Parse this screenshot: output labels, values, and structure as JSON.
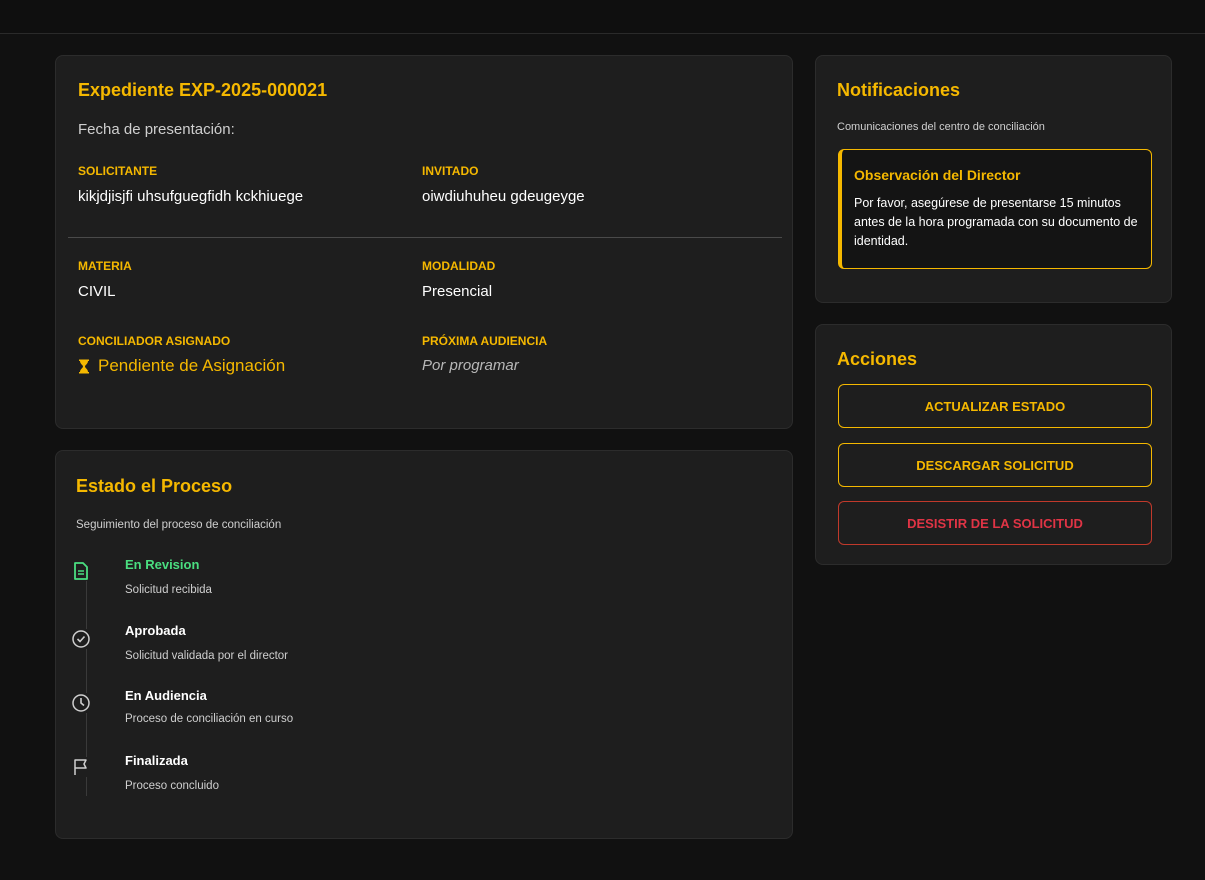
{
  "expediente": {
    "title": "Expediente EXP-2025-000021",
    "fecha_label": "Fecha de presentación:",
    "solicitante_label": "SOLICITANTE",
    "solicitante_value": "kikjdjisjfi uhsufguegfidh kckhiuege",
    "invitado_label": "INVITADO",
    "invitado_value": "oiwdiuhuheu gdeugeyge",
    "materia_label": "MATERIA",
    "materia_value": "CIVIL",
    "modalidad_label": "MODALIDAD",
    "modalidad_value": "Presencial",
    "conciliador_label": "CONCILIADOR ASIGNADO",
    "conciliador_value": "Pendiente de Asignación",
    "audiencia_label": "PRÓXIMA AUDIENCIA",
    "audiencia_value": "Por programar"
  },
  "proceso": {
    "title": "Estado el Proceso",
    "subtitle": "Seguimiento del proceso de conciliación",
    "steps": [
      {
        "title": "En Revision",
        "desc": "Solicitud recibida",
        "icon": "document-icon",
        "active": true
      },
      {
        "title": "Aprobada",
        "desc": "Solicitud validada por el director",
        "icon": "check-circle-icon",
        "active": false
      },
      {
        "title": "En Audiencia",
        "desc": "Proceso de conciliación en curso",
        "icon": "clock-icon",
        "active": false
      },
      {
        "title": "Finalizada",
        "desc": "Proceso concluido",
        "icon": "flag-icon",
        "active": false
      }
    ]
  },
  "notificaciones": {
    "title": "Notificaciones",
    "subtitle": "Comunicaciones del centro de conciliación",
    "note_title": "Observación del Director",
    "note_body": "Por favor, asegúrese de presentarse 15 minutos antes de la hora programada con su documento de identidad."
  },
  "acciones": {
    "title": "Acciones",
    "actualizar": "ACTUALIZAR ESTADO",
    "descargar": "DESCARGAR SOLICITUD",
    "desistir": "DESISTIR DE LA SOLICITUD"
  },
  "colors": {
    "accent": "#f5b800",
    "active_step": "#4ade80",
    "danger": "#e03445"
  }
}
